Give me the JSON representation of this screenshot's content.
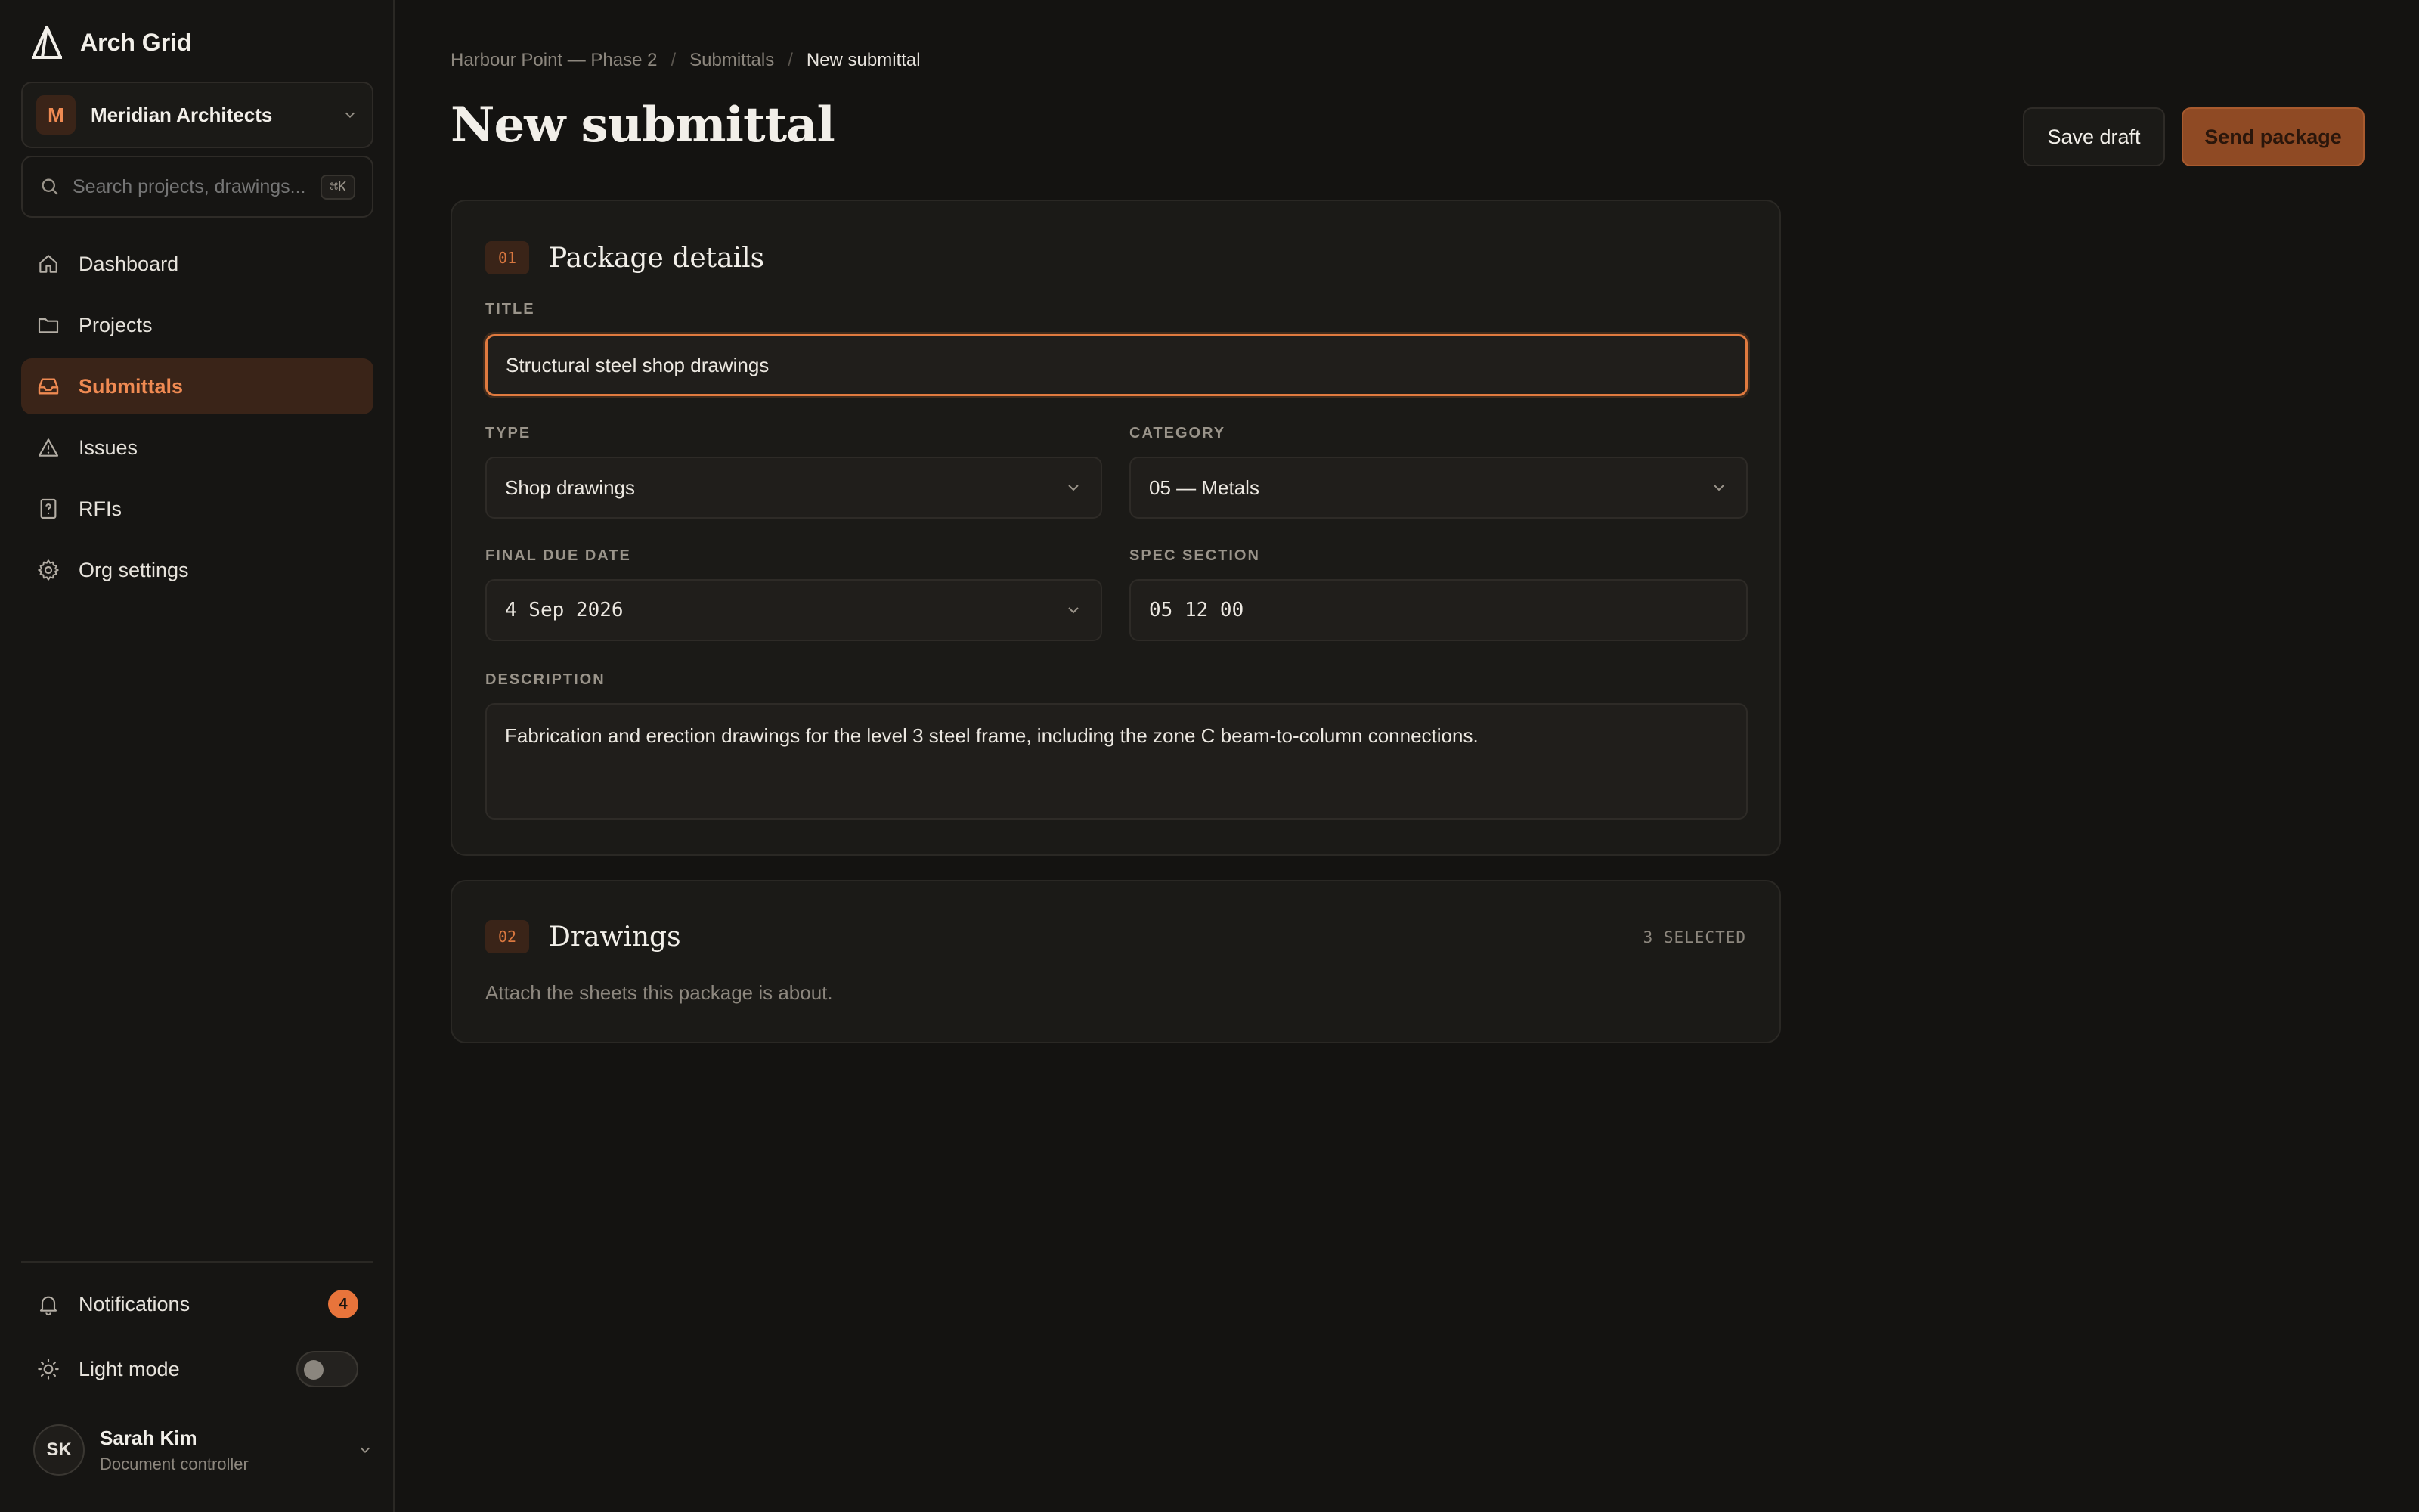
{
  "app": {
    "name": "Arch Grid"
  },
  "org": {
    "initial": "M",
    "name": "Meridian Architects"
  },
  "search": {
    "placeholder": "Search projects, drawings...",
    "shortcut": "⌘K"
  },
  "nav": [
    {
      "label": "Dashboard",
      "icon": "home-icon"
    },
    {
      "label": "Projects",
      "icon": "folder-icon"
    },
    {
      "label": "Submittals",
      "icon": "inbox-icon",
      "active": true
    },
    {
      "label": "Issues",
      "icon": "warning-icon"
    },
    {
      "label": "RFIs",
      "icon": "question-icon"
    },
    {
      "label": "Org settings",
      "icon": "gear-icon"
    }
  ],
  "notifications": {
    "label": "Notifications",
    "count": "4"
  },
  "light_mode": {
    "label": "Light mode",
    "enabled": false
  },
  "user": {
    "initials": "SK",
    "name": "Sarah Kim",
    "role": "Document controller"
  },
  "breadcrumb": {
    "project": "Harbour Point — Phase 2",
    "section": "Submittals",
    "current": "New submittal",
    "separator": "/"
  },
  "page": {
    "title": "New submittal"
  },
  "actions": {
    "save_draft": "Save draft",
    "send_package": "Send package"
  },
  "package": {
    "step": "01",
    "title": "Package details",
    "title_label": "TITLE",
    "title_value": "Structural steel shop drawings",
    "type_label": "TYPE",
    "type_value": "Shop drawings",
    "category_label": "CATEGORY",
    "category_value": "05 — Metals",
    "due_label": "FINAL DUE DATE",
    "due_value": "4 Sep 2026",
    "spec_label": "SPEC SECTION",
    "spec_value": "05 12 00",
    "description_label": "DESCRIPTION",
    "description_value": "Fabrication and erection drawings for the level 3 steel frame, including the zone C beam-to-column connections."
  },
  "drawings": {
    "step": "02",
    "title": "Drawings",
    "selected": "3 SELECTED",
    "subtitle": "Attach the sheets this package is about."
  },
  "colors": {
    "accent": "#e8743b",
    "background": "#141311",
    "surface": "#1b1a17"
  }
}
